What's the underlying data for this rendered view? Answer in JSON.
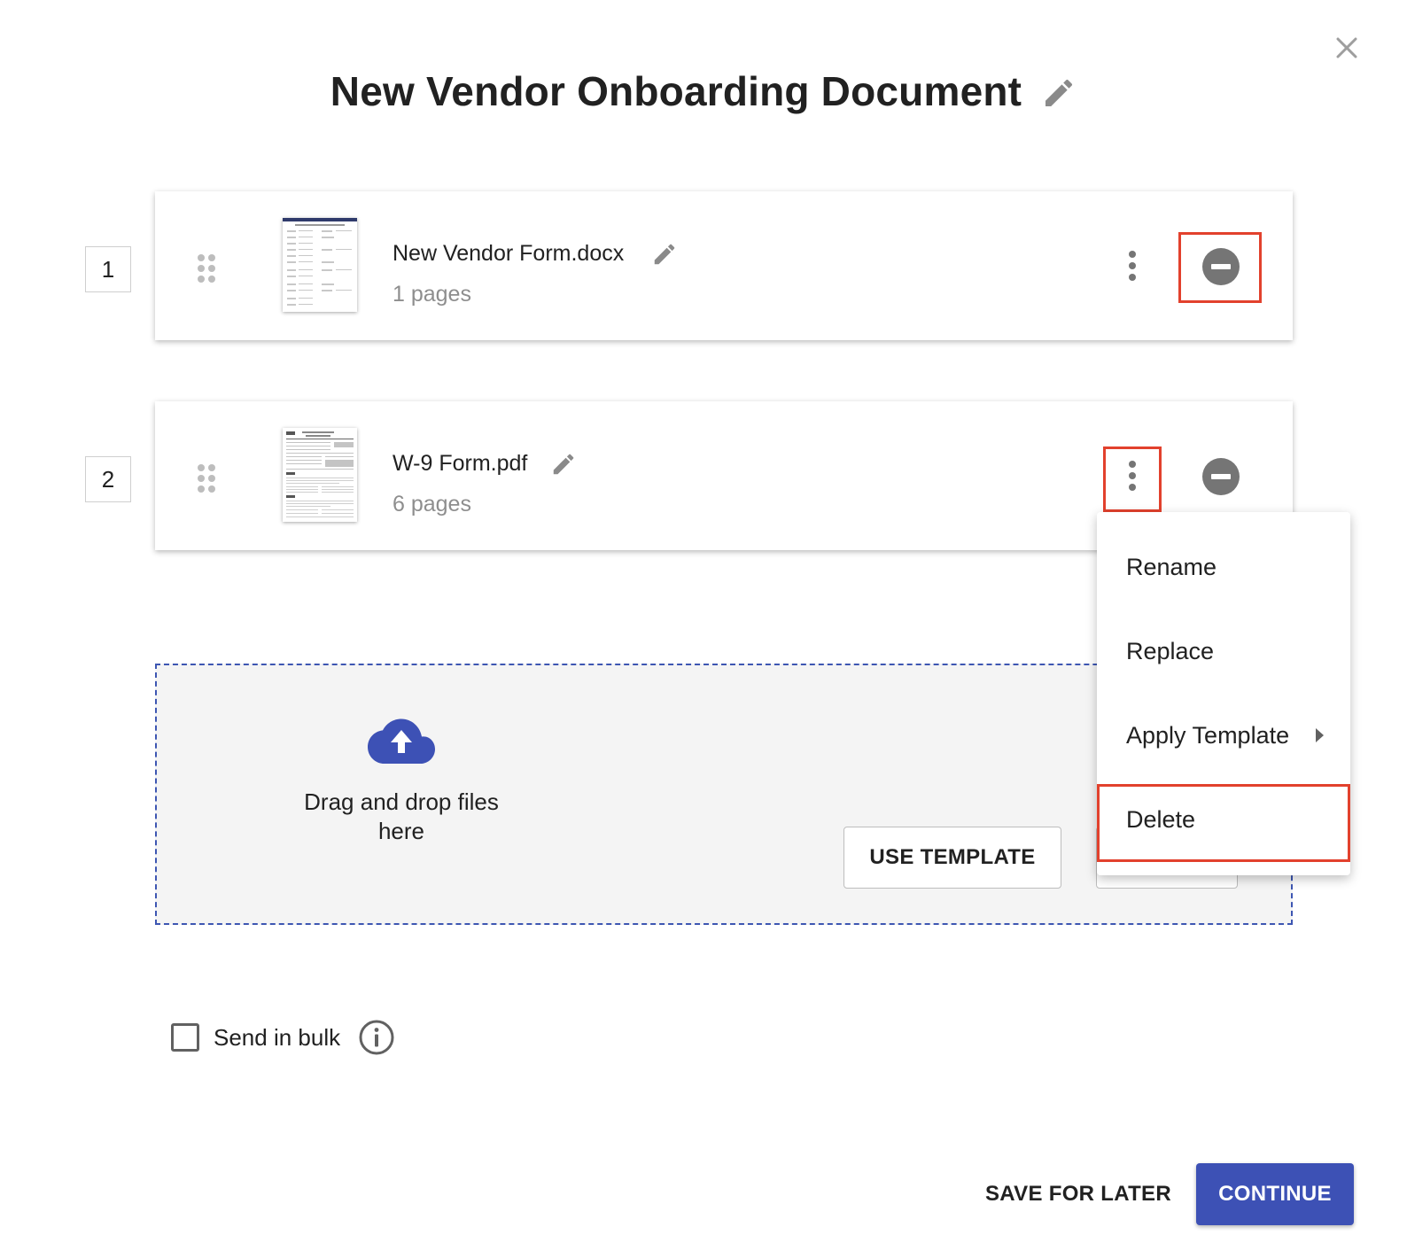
{
  "dialog": {
    "title": "New Vendor Onboarding Document",
    "close_icon": "close-icon",
    "edit_icon": "pencil-icon"
  },
  "documents": [
    {
      "index": "1",
      "name": "New Vendor Form.docx",
      "pages": "1 pages"
    },
    {
      "index": "2",
      "name": "W-9 Form.pdf",
      "pages": "6 pages"
    }
  ],
  "dropzone": {
    "icon": "cloud-upload-icon",
    "text": "Drag and drop files here",
    "use_template_label": "USE TEMPLATE"
  },
  "context_menu": {
    "items": [
      {
        "label": "Rename"
      },
      {
        "label": "Replace"
      },
      {
        "label": "Apply Template",
        "has_submenu": true
      },
      {
        "label": "Delete"
      }
    ]
  },
  "bulk": {
    "label": "Send in bulk",
    "checked": false,
    "info_icon": "info-icon"
  },
  "footer": {
    "save_label": "SAVE FOR LATER",
    "continue_label": "CONTINUE"
  },
  "colors": {
    "accent": "#3d51b5",
    "highlight": "#e2412d",
    "icon_gray": "#757575"
  }
}
